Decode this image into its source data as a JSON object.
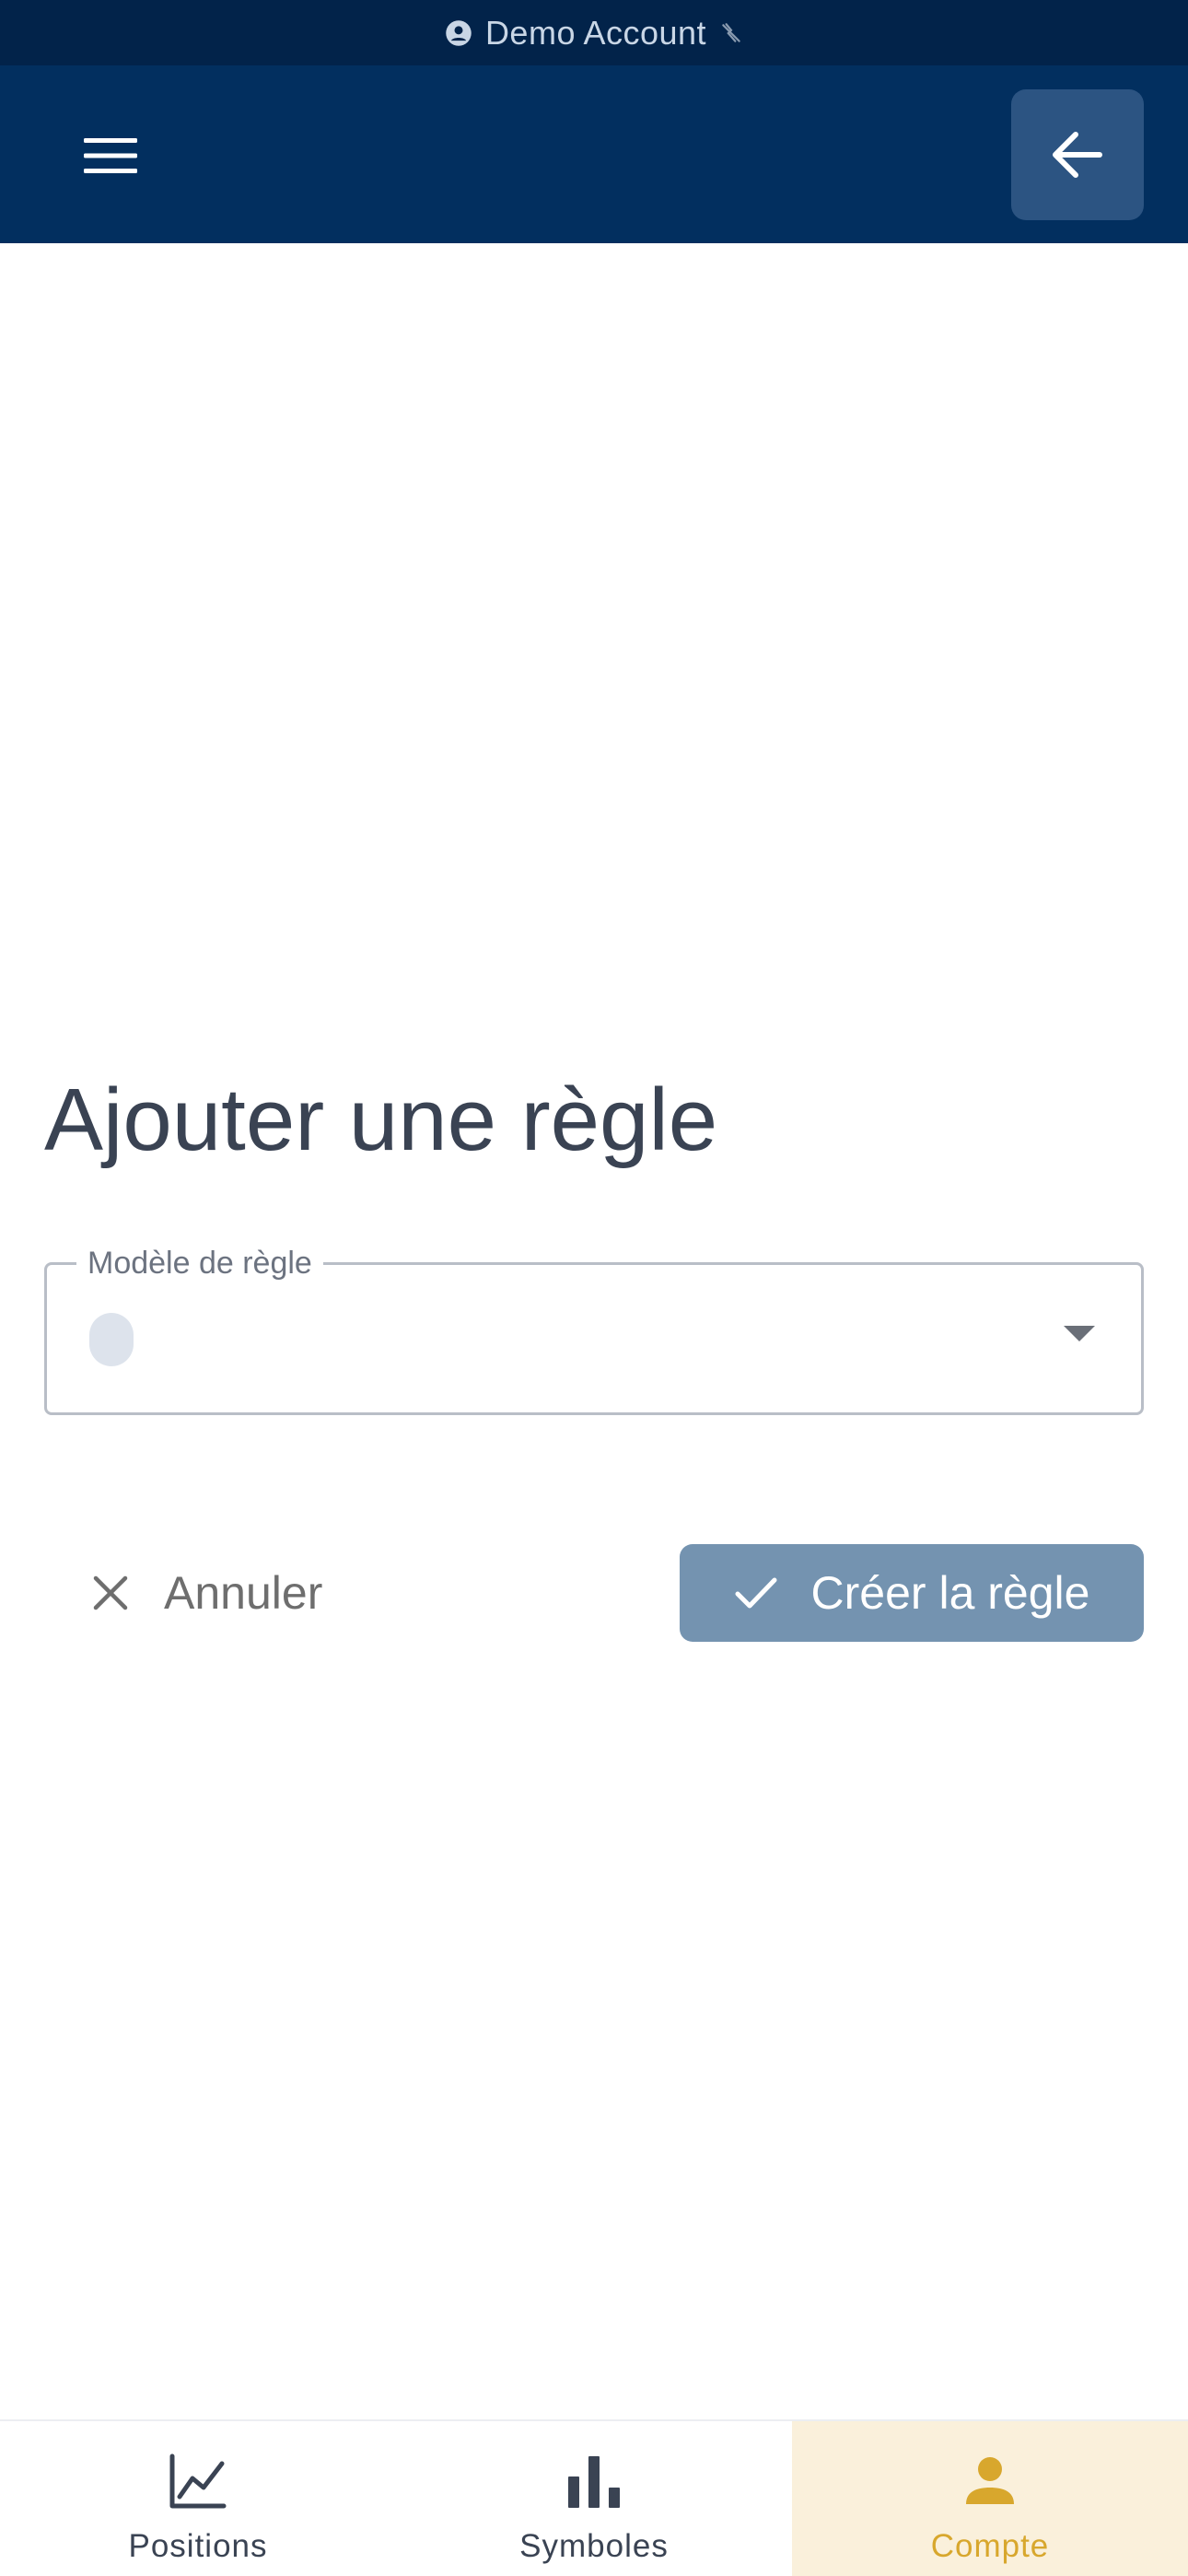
{
  "account_strip": {
    "label": "Demo Account",
    "user_icon": "account-circle-icon",
    "status_icon": "signal-off-icon"
  },
  "header": {
    "menu_icon": "hamburger-menu-icon",
    "back_icon": "arrow-left-icon"
  },
  "form": {
    "title": "Ajouter une règle",
    "rule_model_label": "Modèle de règle",
    "rule_model_value": "",
    "cancel_label": "Annuler",
    "create_label": "Créer la règle"
  },
  "bottom_nav": {
    "items": [
      {
        "label": "Positions",
        "icon": "line-chart-icon",
        "active": false
      },
      {
        "label": "Symboles",
        "icon": "bar-chart-icon",
        "active": false
      },
      {
        "label": "Compte",
        "icon": "person-icon",
        "active": true
      }
    ]
  },
  "colors": {
    "strip_bg": "#02234a",
    "header_bg": "#022f5f",
    "back_button_bg": "#2c5482",
    "primary_button_bg": "#7493b0",
    "active_tab_bg": "#faf0db",
    "active_tab_fg": "#d8a72d",
    "text_dark": "#3a4353"
  }
}
